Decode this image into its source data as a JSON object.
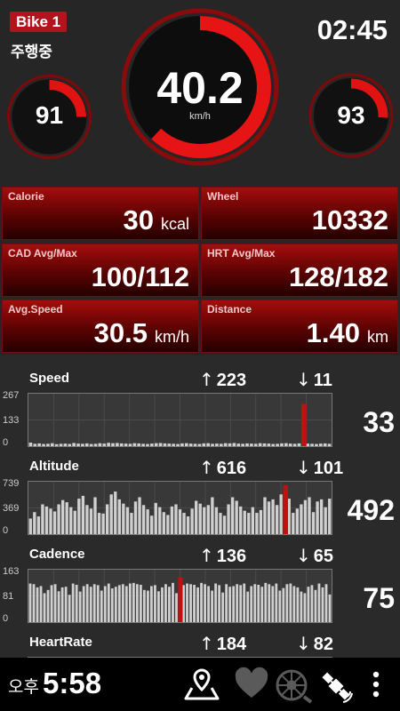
{
  "header": {
    "bike_label": "Bike 1",
    "status": "주행중",
    "timer": "02:45"
  },
  "speed_gauge": {
    "value": "40.2",
    "unit": "km/h",
    "fraction": 0.62
  },
  "left_gauge": {
    "value": "91",
    "fraction": 0.25
  },
  "right_gauge": {
    "value": "93",
    "fraction": 0.26
  },
  "tiles": [
    {
      "label": "Calorie",
      "value": "30",
      "unit": "kcal"
    },
    {
      "label": "Wheel",
      "value": "10332",
      "unit": ""
    },
    {
      "label": "CAD Avg/Max",
      "value": "100/112",
      "unit": ""
    },
    {
      "label": "HRT Avg/Max",
      "value": "128/182",
      "unit": ""
    },
    {
      "label": "Avg.Speed",
      "value": "30.5",
      "unit": "km/h"
    },
    {
      "label": "Distance",
      "value": "1.40",
      "unit": "km"
    }
  ],
  "charts": [
    {
      "title": "Speed",
      "max": "223",
      "min": "11",
      "current": "33",
      "y_ticks": [
        "267",
        "133",
        "0"
      ],
      "ymax": 267,
      "values": [
        18,
        12,
        14,
        11,
        12,
        15,
        10,
        12,
        13,
        11,
        16,
        13,
        12,
        14,
        11,
        12,
        15,
        13,
        17,
        15,
        16,
        14,
        13,
        12,
        15,
        14,
        12,
        11,
        13,
        15,
        16,
        14,
        13,
        12,
        11,
        14,
        15,
        13,
        12,
        11,
        14,
        15,
        12,
        13,
        12,
        15,
        14,
        16,
        13,
        12,
        14,
        13,
        12,
        15,
        14,
        13,
        11,
        12,
        14,
        15,
        13,
        12,
        14,
        16,
        13,
        12,
        11,
        13,
        14,
        12
      ],
      "marker_index": 63,
      "marker_value": 215
    },
    {
      "title": "Altitude",
      "max": "616",
      "min": "101",
      "current": "492",
      "y_ticks": [
        "739",
        "369",
        "0"
      ],
      "ymax": 739,
      "values": [
        220,
        310,
        250,
        420,
        390,
        360,
        320,
        420,
        480,
        450,
        380,
        330,
        500,
        540,
        410,
        360,
        520,
        300,
        290,
        420,
        560,
        600,
        490,
        430,
        380,
        300,
        460,
        520,
        410,
        350,
        260,
        440,
        380,
        310,
        270,
        390,
        420,
        350,
        300,
        250,
        360,
        470,
        430,
        380,
        410,
        520,
        380,
        300,
        260,
        420,
        520,
        470,
        390,
        330,
        300,
        380,
        300,
        340,
        520,
        460,
        490,
        410,
        560,
        620,
        500,
        300,
        360,
        420,
        480,
        520,
        310,
        460,
        490,
        380,
        500
      ],
      "marker_index": 63,
      "marker_value": 690
    },
    {
      "title": "Cadence",
      "max": "136",
      "min": "65",
      "current": "75",
      "y_ticks": [
        "163",
        "81",
        "0"
      ],
      "ymax": 163,
      "values": [
        120,
        118,
        108,
        112,
        90,
        100,
        115,
        118,
        96,
        108,
        110,
        85,
        120,
        116,
        95,
        112,
        118,
        110,
        118,
        115,
        98,
        112,
        120,
        105,
        110,
        115,
        118,
        112,
        120,
        122,
        118,
        116,
        100,
        98,
        112,
        115,
        96,
        108,
        118,
        110,
        122,
        90,
        112,
        115,
        120,
        118,
        116,
        108,
        122,
        118,
        112,
        98,
        120,
        115,
        92,
        118,
        110,
        112,
        118,
        115,
        120,
        95,
        112,
        118,
        116,
        110,
        122,
        118,
        112,
        120,
        98,
        106,
        118,
        120,
        112,
        108,
        95,
        90,
        110,
        115,
        100,
        120,
        108,
        118,
        86
      ],
      "marker_index": 42,
      "marker_value": 140
    },
    {
      "title": "HeartRate",
      "max": "184",
      "min": "82",
      "current": "",
      "y_ticks": [
        "",
        "",
        ""
      ],
      "ymax": 200,
      "values": [],
      "marker_index": -1,
      "marker_value": 0
    }
  ],
  "bottom_bar": {
    "ampm": "오후",
    "time": "5:58",
    "icons": [
      "map-icon",
      "heart-icon",
      "wheel-icon",
      "satellite-icon",
      "more-icon"
    ]
  },
  "colors": {
    "accent": "#c01010",
    "bar": "#d0d0d0",
    "tile_top": "#a60c0c",
    "background": "#262626"
  }
}
